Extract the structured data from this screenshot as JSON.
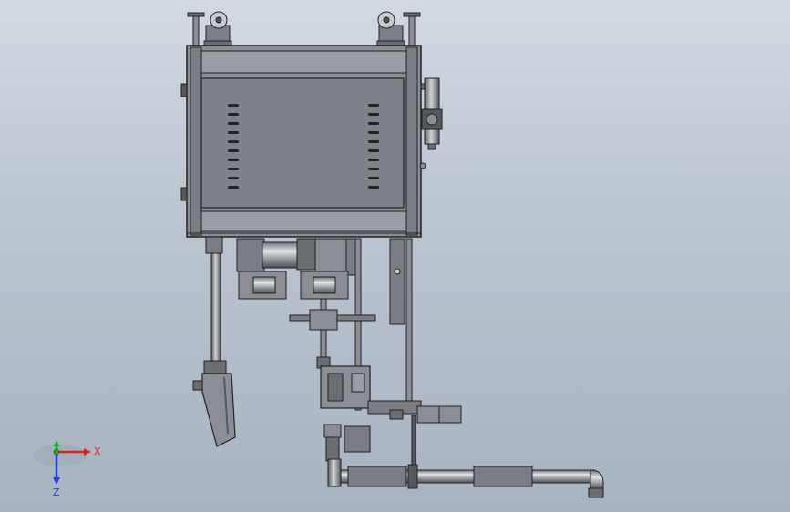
{
  "triad": {
    "x_label": "X",
    "y_label": "Y",
    "z_label": "Z",
    "x_color": "#e02020",
    "y_color": "#20b020",
    "z_color": "#2040e0"
  },
  "colors": {
    "background_top": "#d2d9e1",
    "background_bottom": "#a7b3c0",
    "metal_face": "#8b8f95",
    "metal_dark": "#55585d",
    "metal_light": "#c9ccd0",
    "outline": "#222222"
  },
  "parts": [
    "control-cabinet",
    "caster-wheel-left",
    "caster-wheel-right",
    "leveling-foot-left",
    "leveling-foot-right",
    "side-cylinder",
    "motor-assembly",
    "gear-reducer",
    "vertical-column",
    "spray-head",
    "valve-block",
    "horizontal-pipe",
    "pipe-elbow",
    "pipe-nozzle",
    "horizontal-bracket"
  ]
}
